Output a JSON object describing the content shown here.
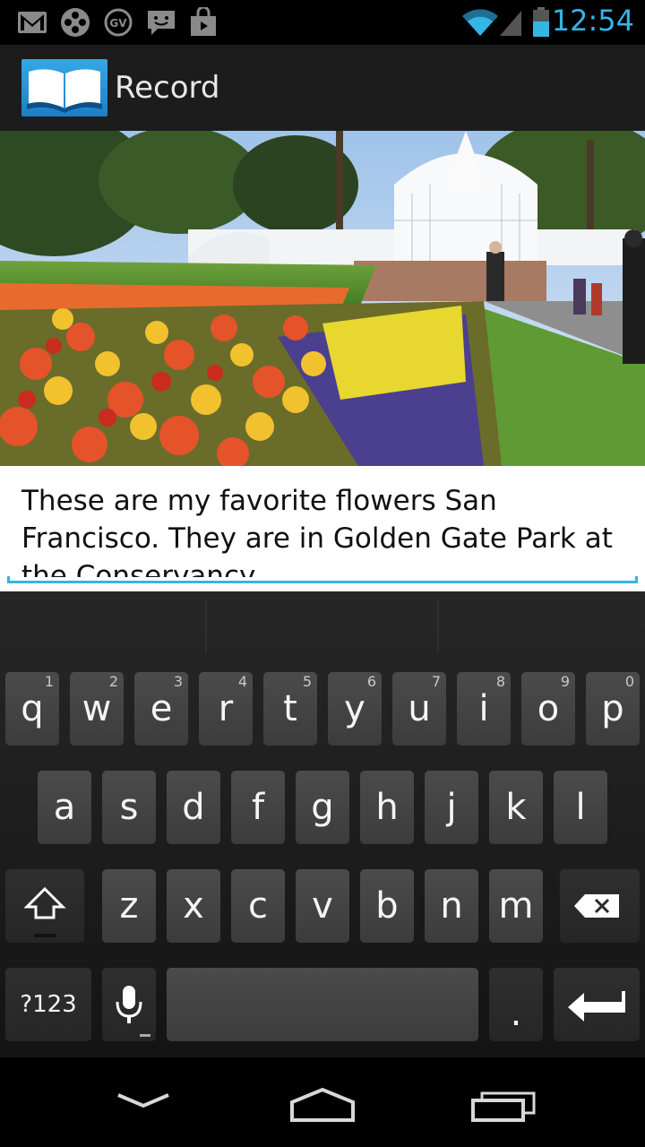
{
  "status_bar": {
    "time": "12:54",
    "icons": [
      "gmail-icon",
      "film-reel-icon",
      "google-voice-icon",
      "messaging-icon",
      "shopping-bag-icon",
      "wifi-icon",
      "signal-icon",
      "battery-icon"
    ]
  },
  "action_bar": {
    "title": "Record",
    "icon": "open-book-icon"
  },
  "photo": {
    "description_icon": "garden-photo"
  },
  "note": {
    "text": "These are my favorite flowers San Francisco. They are in Golden Gate Park at the Conservancy."
  },
  "keyboard": {
    "row1": [
      {
        "label": "q",
        "hint": "1"
      },
      {
        "label": "w",
        "hint": "2"
      },
      {
        "label": "e",
        "hint": "3"
      },
      {
        "label": "r",
        "hint": "4"
      },
      {
        "label": "t",
        "hint": "5"
      },
      {
        "label": "y",
        "hint": "6"
      },
      {
        "label": "u",
        "hint": "7"
      },
      {
        "label": "i",
        "hint": "8"
      },
      {
        "label": "o",
        "hint": "9"
      },
      {
        "label": "p",
        "hint": "0"
      }
    ],
    "row2": [
      "a",
      "s",
      "d",
      "f",
      "g",
      "h",
      "j",
      "k",
      "l"
    ],
    "row3": [
      "z",
      "x",
      "c",
      "v",
      "b",
      "n",
      "m"
    ],
    "symbols_label": "?123",
    "period_label": ".",
    "colors": {
      "key": "#444444",
      "accent": "#33b5e5"
    }
  },
  "nav_bar": {
    "icons": [
      "back-icon",
      "home-icon",
      "recent-apps-icon"
    ]
  }
}
